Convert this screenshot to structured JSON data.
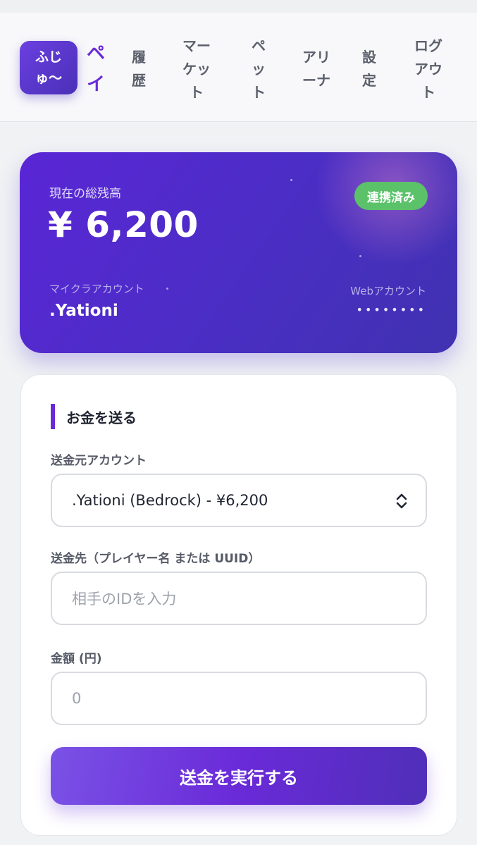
{
  "nav": {
    "logo": "ふじゅ〜",
    "items": [
      {
        "label": "ペイ",
        "active": true
      },
      {
        "label": "履歴",
        "active": false
      },
      {
        "label": "マーケット",
        "active": false
      },
      {
        "label": "ペット",
        "active": false
      },
      {
        "label": "アリーナ",
        "active": false
      },
      {
        "label": "設定",
        "active": false
      },
      {
        "label": "ログアウト",
        "active": false
      }
    ]
  },
  "balance": {
    "label": "現在の総残高",
    "amount": "¥ 6,200",
    "status_badge": "連携済み",
    "minecraft_label": "マイクラアカウント",
    "minecraft_name": ".Yationi",
    "web_label": "Webアカウント",
    "web_password": "••••••••"
  },
  "form": {
    "title": "お金を送る",
    "from_label": "送金元アカウント",
    "from_value": ".Yationi (Bedrock) - ¥6,200",
    "to_label": "送金先（プレイヤー名 または UUID）",
    "to_placeholder": "相手のIDを入力",
    "amount_label": "金額 (円)",
    "amount_placeholder": "0",
    "submit_label": "送金を実行する"
  },
  "colors": {
    "accent": "#6a2ad8",
    "card_start": "#5a26d6",
    "card_end": "#3f32b0",
    "badge": "#5bc26a"
  }
}
